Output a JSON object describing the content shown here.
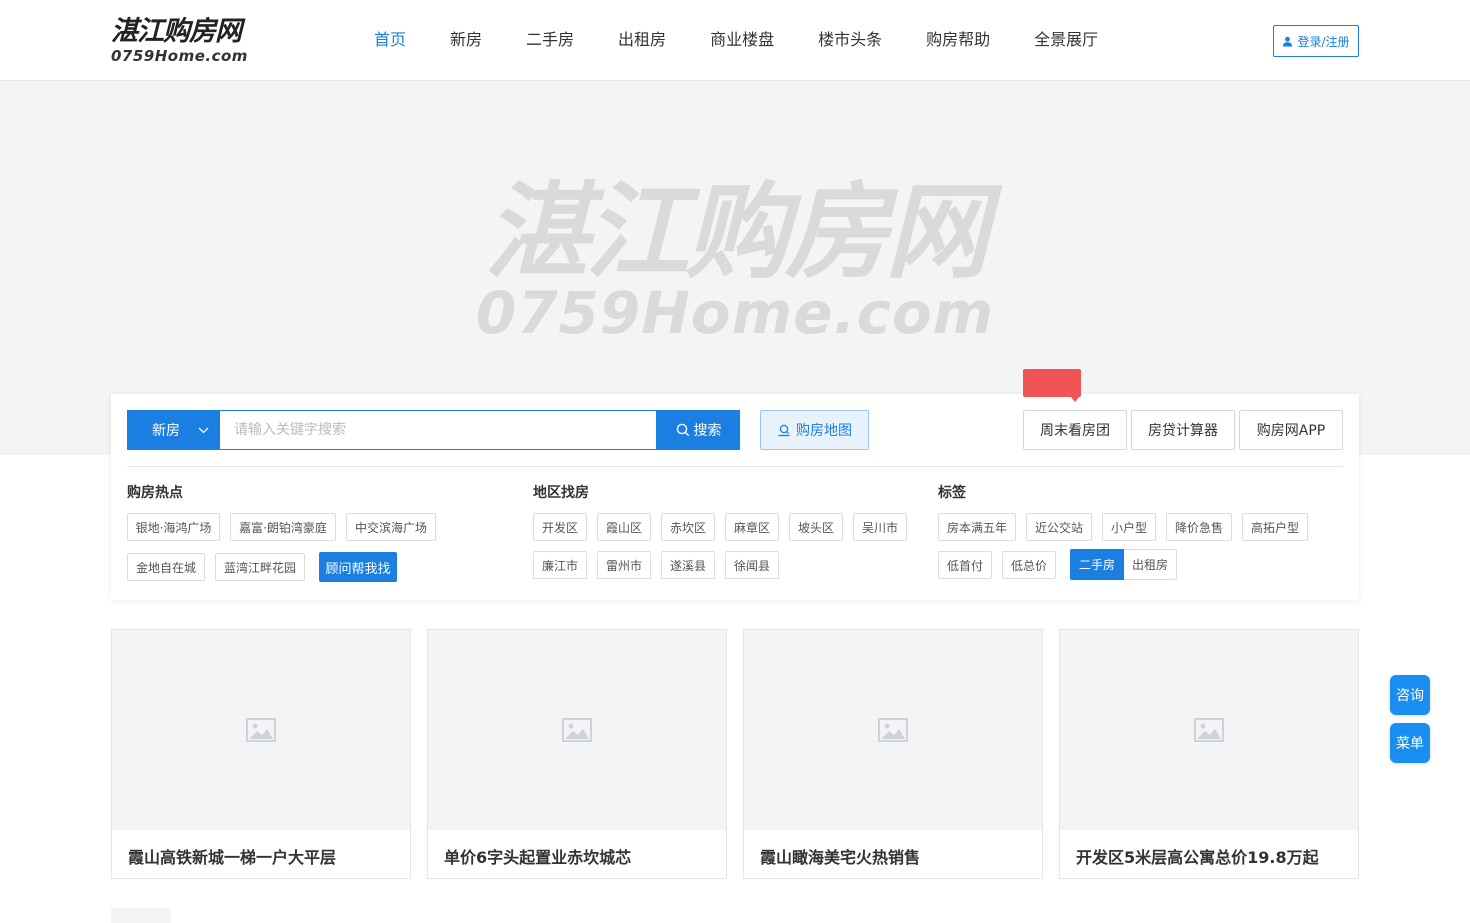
{
  "header": {
    "logo_cn": "湛江购房网",
    "logo_en": "0759Home.com",
    "nav": [
      "首页",
      "新房",
      "二手房",
      "出租房",
      "商业楼盘",
      "楼市头条",
      "购房帮助",
      "全景展厅"
    ],
    "login_label": "登录/注册"
  },
  "banner": {
    "watermark_cn": "湛江购房网",
    "watermark_en": "0759Home.com"
  },
  "search": {
    "type_label": "新房",
    "placeholder": "请输入关键字搜索",
    "search_label": "搜索",
    "map_label": "购房地图",
    "tools": [
      "周末看房团",
      "房贷计算器",
      "购房网APP"
    ]
  },
  "hot": {
    "title": "购房热点",
    "items": [
      "银地·海鸿广场",
      "嘉富·朗铂湾豪庭",
      "中交滨海广场",
      "金地自在城",
      "蓝湾江畔花园"
    ],
    "advisor_label": "顾问帮我找"
  },
  "region": {
    "title": "地区找房",
    "items": [
      "开发区",
      "霞山区",
      "赤坎区",
      "麻章区",
      "坡头区",
      "吴川市",
      "廉江市",
      "雷州市",
      "遂溪县",
      "徐闻县"
    ]
  },
  "labels": {
    "title": "标签",
    "items": [
      "房本满五年",
      "近公交站",
      "小户型",
      "降价急售",
      "高拓户型",
      "低首付",
      "低总价"
    ],
    "toggle": [
      "二手房",
      "出租房"
    ]
  },
  "cards": [
    {
      "title": "霞山高铁新城一梯一户大平层"
    },
    {
      "title": "单价6字头起置业赤坎城芯"
    },
    {
      "title": "霞山瞰海美宅火热销售"
    },
    {
      "title": "开发区5米层高公寓总价19.8万起"
    }
  ],
  "float": {
    "consult_label": "咨询",
    "menu_label": "菜单"
  },
  "colors": {
    "accent": "#1a7fe0",
    "badge": "#f05454"
  }
}
